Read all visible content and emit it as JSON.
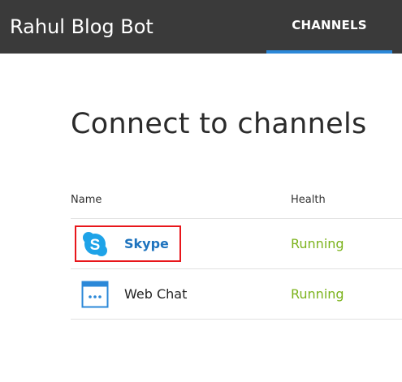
{
  "header": {
    "app_title": "Rahul Blog Bot",
    "tab_label": "CHANNELS",
    "accent": "#2b88d8"
  },
  "main": {
    "heading": "Connect to channels",
    "columns": {
      "name": "Name",
      "health": "Health"
    },
    "channels": [
      {
        "name": "Skype",
        "health": "Running",
        "icon": "skype-icon"
      },
      {
        "name": "Web Chat",
        "health": "Running",
        "icon": "web-chat-icon"
      }
    ],
    "health_color": "#7cb31c",
    "highlight_color": "#e8161b"
  }
}
